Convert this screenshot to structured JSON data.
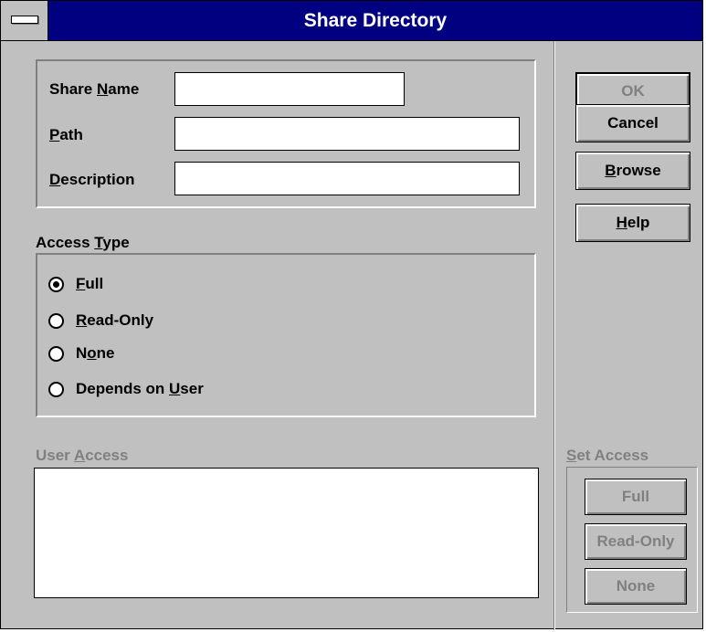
{
  "window": {
    "title": "Share Directory"
  },
  "share_fields": {
    "share_name": {
      "label": "Share Name",
      "value": ""
    },
    "path": {
      "label": "Path",
      "value": ""
    },
    "description": {
      "label": "Description",
      "value": ""
    }
  },
  "access_type": {
    "label": "Access Type",
    "options": [
      {
        "label": "Full",
        "selected": true
      },
      {
        "label": "Read-Only",
        "selected": false
      },
      {
        "label": "None",
        "selected": false
      },
      {
        "label": "Depends on User",
        "selected": false
      }
    ]
  },
  "user_access": {
    "label": "User Access",
    "items": []
  },
  "buttons": {
    "ok": "OK",
    "cancel": "Cancel",
    "browse": "Browse",
    "help": "Help"
  },
  "set_access": {
    "label": "Set Access",
    "full": "Full",
    "read_only": "Read-Only",
    "none": "None"
  },
  "colors": {
    "title_bar": "#000080",
    "face": "#c0c0c0",
    "disabled_text": "#808080"
  }
}
